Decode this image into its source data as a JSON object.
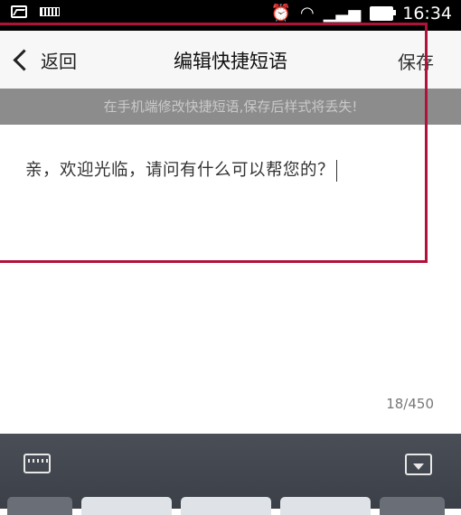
{
  "status_bar": {
    "time": "16:34",
    "icons": [
      "image-icon",
      "keyboard-icon",
      "alarm-icon",
      "wifi-icon",
      "signal-icon",
      "battery-icon"
    ]
  },
  "header": {
    "back_label": "返回",
    "title": "编辑快捷短语",
    "save_label": "保存"
  },
  "notice": "在手机端修改快捷短语,保存后样式将丢失!",
  "editor": {
    "text": "亲，欢迎光临，请问有什么可以帮您的？",
    "char_count": "18/450"
  },
  "keyboard_bar": {
    "icons": [
      "keyboard-toggle-icon",
      "hide-keyboard-icon"
    ]
  },
  "colors": {
    "highlight": "#b0123a",
    "notice_bg": "#8c8c8c",
    "keyboard_bg": "#3f434b"
  }
}
